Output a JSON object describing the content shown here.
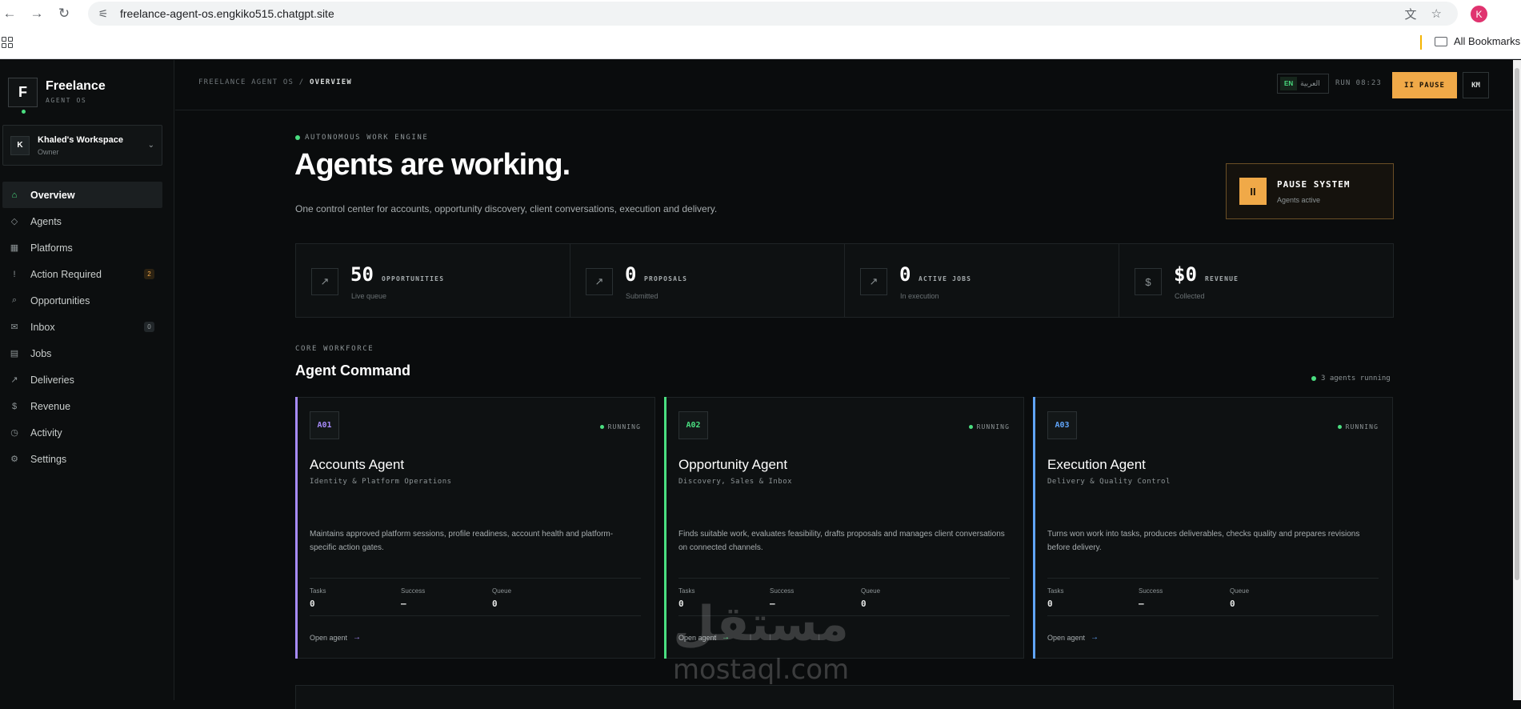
{
  "browser": {
    "url": "freelance-agent-os.engkiko515.chatgpt.site",
    "profile_initial": "K",
    "all_bookmarks": "All Bookmarks"
  },
  "brand": {
    "mark": "F",
    "name": "Freelance",
    "sub": "AGENT OS"
  },
  "workspace": {
    "initial": "K",
    "name": "Khaled's Workspace",
    "role": "Owner"
  },
  "sidebar": {
    "items": [
      {
        "label": "Overview",
        "icon": "home-icon",
        "glyph": "⌂",
        "active": true
      },
      {
        "label": "Agents",
        "icon": "diamond-icon",
        "glyph": "◇"
      },
      {
        "label": "Platforms",
        "icon": "grid-icon",
        "glyph": "▦"
      },
      {
        "label": "Action Required",
        "icon": "alert-icon",
        "glyph": "!",
        "badge": "2"
      },
      {
        "label": "Opportunities",
        "icon": "search-icon",
        "glyph": "⌕"
      },
      {
        "label": "Inbox",
        "icon": "mail-icon",
        "glyph": "✉",
        "badge": "0"
      },
      {
        "label": "Jobs",
        "icon": "list-icon",
        "glyph": "▤"
      },
      {
        "label": "Deliveries",
        "icon": "send-icon",
        "glyph": "↗"
      },
      {
        "label": "Revenue",
        "icon": "dollar-icon",
        "glyph": "$"
      },
      {
        "label": "Activity",
        "icon": "clock-icon",
        "glyph": "◷"
      },
      {
        "label": "Settings",
        "icon": "gear-icon",
        "glyph": "⚙"
      }
    ]
  },
  "topbar": {
    "crumb_root": "FREELANCE AGENT OS",
    "crumb_sep": "/",
    "crumb_current": "OVERVIEW",
    "lang_en": "EN",
    "lang_ar": "العربية",
    "run": "RUN 08:23",
    "pause_label": "PAUSE",
    "user_initials": "KM"
  },
  "hero": {
    "eyebrow": "AUTONOMOUS WORK ENGINE",
    "title": "Agents are working.",
    "subtitle": "One control center for accounts, opportunity discovery, client conversations, execution and delivery.",
    "pause_title": "PAUSE SYSTEM",
    "pause_sub": "Agents active",
    "pause_glyph": "II"
  },
  "stats": [
    {
      "value": "50",
      "label": "OPPORTUNITIES",
      "caption": "Live queue",
      "glyph": "↗"
    },
    {
      "value": "0",
      "label": "PROPOSALS",
      "caption": "Submitted",
      "glyph": "↗"
    },
    {
      "value": "0",
      "label": "ACTIVE JOBS",
      "caption": "In execution",
      "glyph": "↗"
    },
    {
      "value": "$0",
      "label": "REVENUE",
      "caption": "Collected",
      "glyph": "$"
    }
  ],
  "workforce": {
    "eyebrow": "CORE WORKFORCE",
    "title": "Agent Command",
    "running": "3 agents running",
    "metric_labels": [
      "Tasks",
      "Success",
      "Queue"
    ],
    "open_label": "Open agent",
    "open_arrow": "→"
  },
  "agents": [
    {
      "code": "A01",
      "color": "#a78bfa",
      "status": "RUNNING",
      "name": "Accounts Agent",
      "role": "Identity & Platform Operations",
      "desc": "Maintains approved platform sessions, profile readiness, account health and platform-specific action gates.",
      "tasks": "0",
      "success": "—",
      "queue": "0"
    },
    {
      "code": "A02",
      "color": "#4ade80",
      "status": "RUNNING",
      "name": "Opportunity Agent",
      "role": "Discovery, Sales & Inbox",
      "desc": "Finds suitable work, evaluates feasibility, drafts proposals and manages client conversations on connected channels.",
      "tasks": "0",
      "success": "—",
      "queue": "0"
    },
    {
      "code": "A03",
      "color": "#60a5fa",
      "status": "RUNNING",
      "name": "Execution Agent",
      "role": "Delivery & Quality Control",
      "desc": "Turns won work into tasks, produces deliverables, checks quality and prepares revisions before delivery.",
      "tasks": "0",
      "success": "—",
      "queue": "0"
    }
  ],
  "watermark": {
    "arabic": "مستقل",
    "latin": "mostaql.com"
  }
}
